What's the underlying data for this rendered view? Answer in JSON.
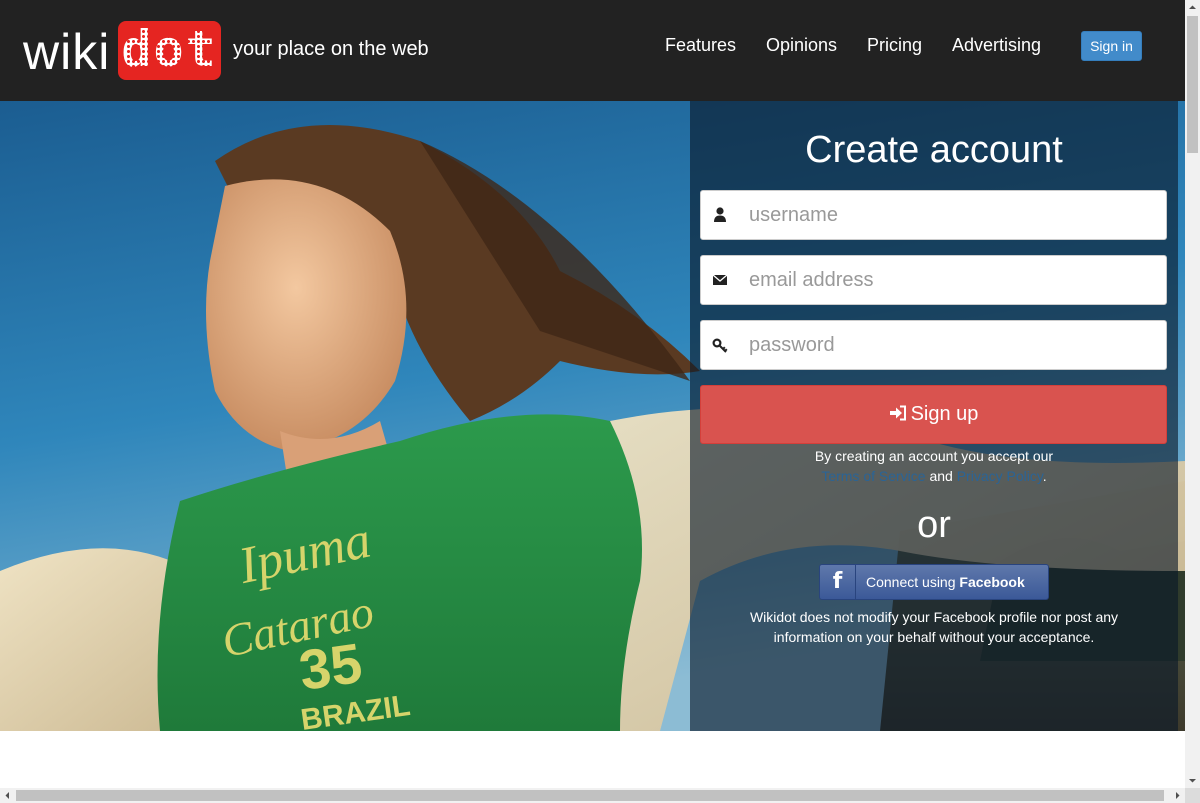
{
  "header": {
    "logo_wiki": "wiki",
    "logo_dot": "dot",
    "tagline": "your place on the web",
    "nav": [
      "Features",
      "Opinions",
      "Pricing",
      "Advertising"
    ],
    "sign_in": "Sign in"
  },
  "signup": {
    "title": "Create account",
    "username_placeholder": "username",
    "email_placeholder": "email address",
    "password_placeholder": "password",
    "button_label": "Sign up",
    "terms_prefix": "By creating an account you accept our",
    "terms_link": "Terms of Service",
    "terms_and": "and",
    "privacy_link": "Privacy Policy",
    "terms_suffix": ".",
    "or": "or",
    "facebook_connect": "Connect using",
    "facebook_brand": "Facebook",
    "facebook_note": "Wikidot does not modify your Facebook profile nor post any information on your behalf without your acceptance."
  },
  "colors": {
    "header_bg": "#222222",
    "logo_red": "#e52521",
    "signin_blue": "#428bca",
    "signup_red": "#d9534f",
    "facebook_blue": "#3b5998",
    "link_blue": "#2a6496"
  },
  "icons": {
    "username": "user-icon",
    "email": "envelope-icon",
    "password": "key-icon",
    "signup": "sign-in-icon",
    "facebook": "facebook-icon"
  }
}
